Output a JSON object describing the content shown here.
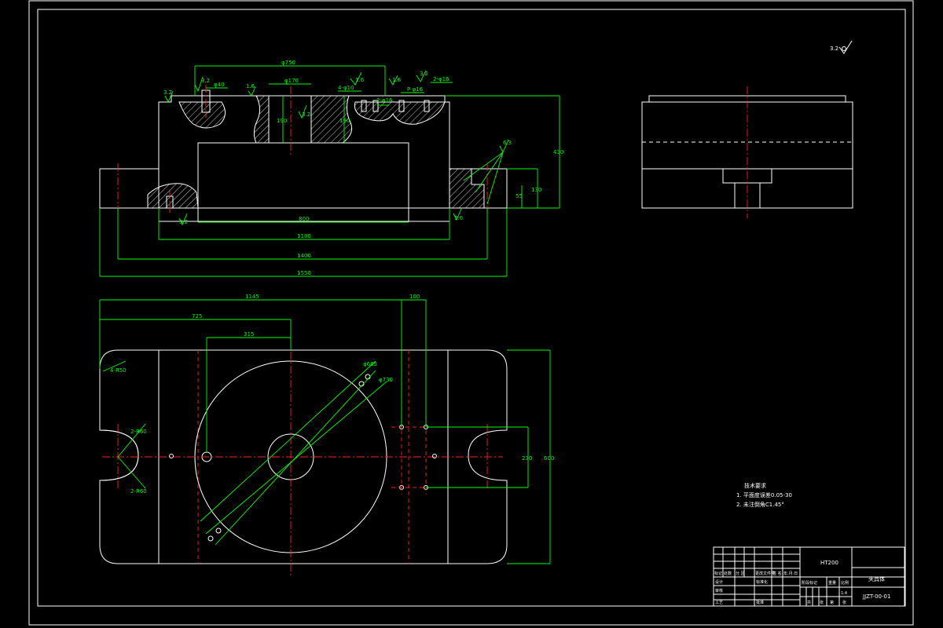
{
  "dimensions": {
    "d_top_phi": "φ750",
    "d_phi170": "φ170",
    "d_phi40": "φ40",
    "d_hole_a": "4-φ10",
    "d_hole_b": "2-φ16",
    "d_hole_c": "P-φ16",
    "d_hole_d": "2-φ16",
    "d_190": "190",
    "d_190b": "190",
    "d_430": "430",
    "d_130": "130",
    "d_55": "55",
    "d_800": "800",
    "d_1180": "1180",
    "d_1400": "1400",
    "d_1550": "1550",
    "p_1145": "1145",
    "p_100": "100",
    "p_725": "725",
    "p_315": "315",
    "p_230": "230",
    "p_600": "600",
    "p_r250": "4-R50",
    "p_d665": "φ665",
    "p_d730": "φ730",
    "p_r60a": "2-R60",
    "p_r60b": "2-R60"
  },
  "surface_finish": {
    "general": "3.2",
    "s1": "3.2",
    "s2": "3.2",
    "s3": "1.6",
    "s4": "3.2",
    "s5": "1.6",
    "s6": "1.6",
    "s7": "3.2",
    "s8": "6.3",
    "s9": "3.2",
    "s10": "1.6"
  },
  "technical_requirements": {
    "title": "技术要求",
    "items": [
      "1. 平面度误差0.05-30",
      "2. 未注倒角C1.45°"
    ]
  },
  "title_block": {
    "material": "HT200",
    "part_name": "夹具体",
    "drawing_no": "JJZT-00-01",
    "headers": [
      "标记",
      "处数",
      "分 区",
      "更改文件号",
      "签 名",
      "年.月.日"
    ],
    "row_labels": [
      "设计",
      "审核",
      "工艺"
    ],
    "col_labels": [
      "标准化",
      "批准"
    ],
    "stage_labels": [
      "阶段标记",
      "重量",
      "比例"
    ],
    "scale": "1:4",
    "sheet_info": [
      "共",
      "张",
      "第",
      "张"
    ]
  }
}
